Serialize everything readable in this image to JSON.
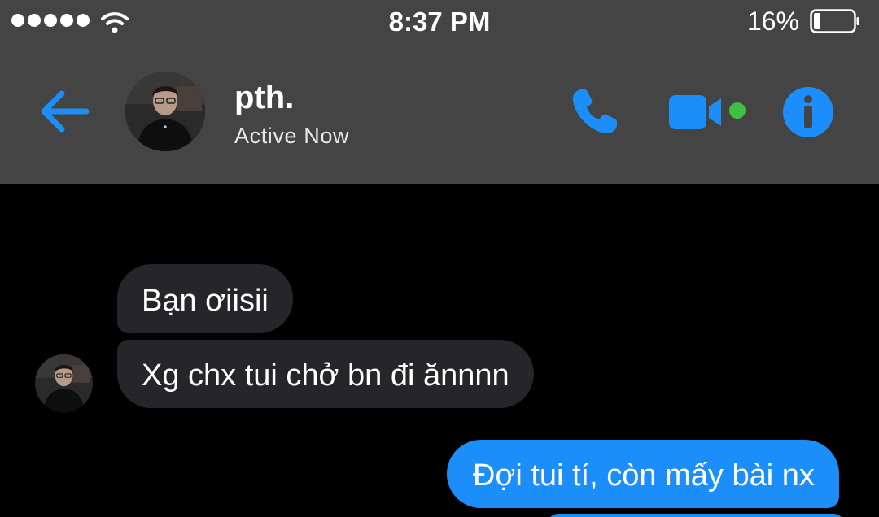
{
  "status_bar": {
    "signal_icon": "signal-dots-icon",
    "wifi_icon": "wifi-icon",
    "time": "8:37 PM",
    "battery_percent": "16%",
    "battery_icon": "battery-icon"
  },
  "header": {
    "back_icon": "back-arrow-icon",
    "contact_name": "pth.",
    "contact_status": "Active Now",
    "call_icon": "phone-icon",
    "video_icon": "video-camera-icon",
    "info_icon": "info-icon"
  },
  "messages": [
    {
      "direction": "incoming",
      "text": "Bạn ơiisii"
    },
    {
      "direction": "incoming",
      "text": "Xg chx tui chở bn đi ănnnn"
    },
    {
      "direction": "outgoing",
      "text": "Đợi tui tí, còn mấy bài nx"
    }
  ],
  "colors": {
    "chrome_bg": "#444444",
    "accent_blue": "#1c8ef9",
    "incoming_bubble": "#262529",
    "online_green": "#3fc13f",
    "chat_bg": "#000000"
  }
}
